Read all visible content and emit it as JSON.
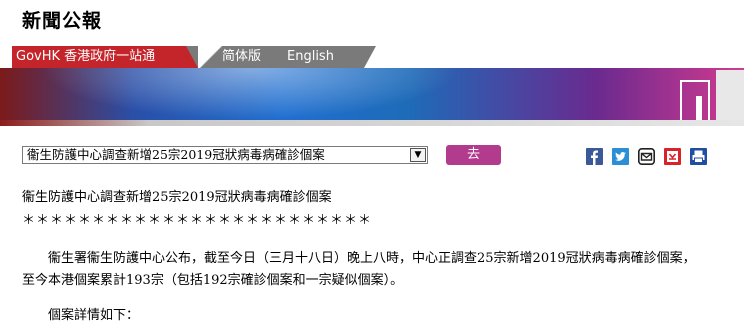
{
  "header": {
    "brand": "新聞公報"
  },
  "nav": {
    "gov_label": "GovHK 香港政府一站通",
    "simplified": "简体版",
    "english": "English"
  },
  "toolbar": {
    "select_value": "衞生防護中心調查新增25宗2019冠狀病毒病確診個案",
    "go_label": "去",
    "share_icons": [
      "facebook-icon",
      "twitter-icon",
      "email-icon",
      "bookmark-icon",
      "print-icon"
    ]
  },
  "article": {
    "title": "衞生防護中心調查新增25宗2019冠狀病毒病確診個案",
    "stars": "＊＊＊＊＊＊＊＊＊＊＊＊＊＊＊＊＊＊＊＊＊＊＊＊＊",
    "paragraph_line1": "衞生署衞生防護中心公布，截至今日（三月十八日）晚上八時，中心正調查25宗新增2019冠狀病毒病確診個案，",
    "paragraph_line2": "至今本港個案累計193宗（包括192宗確診個案和一宗疑似個案）。",
    "details_label": "個案詳情如下："
  },
  "colors": {
    "nav_red": "#c3252b",
    "nav_grey": "#7a7a7a",
    "go_button": "#b23b8e"
  }
}
